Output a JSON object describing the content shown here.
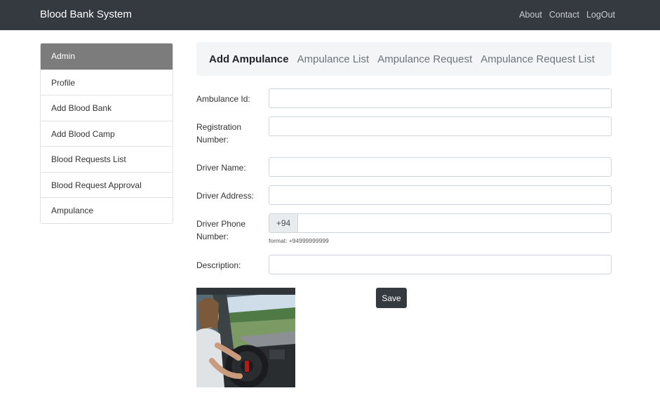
{
  "navbar": {
    "brand": "Blood Bank System",
    "links": [
      "About",
      "Contact",
      "LogOut"
    ]
  },
  "sidebar": {
    "items": [
      {
        "label": "Admin",
        "active": true
      },
      {
        "label": "Profile"
      },
      {
        "label": "Add Blood Bank"
      },
      {
        "label": "Add Blood Camp"
      },
      {
        "label": "Blood Requests List"
      },
      {
        "label": "Blood Request Approval"
      },
      {
        "label": "Ampulance"
      }
    ]
  },
  "tabs": [
    {
      "label": "Add Ampulance",
      "active": true
    },
    {
      "label": "Ampulance List"
    },
    {
      "label": "Ampulance Request"
    },
    {
      "label": "Ampulance Request List"
    }
  ],
  "form": {
    "ambulance_id": {
      "label": "Ambulance Id:",
      "value": ""
    },
    "registration": {
      "label": "Registration Number:",
      "value": ""
    },
    "driver_name": {
      "label": "Driver Name:",
      "value": ""
    },
    "driver_address": {
      "label": "Driver Address:",
      "value": ""
    },
    "driver_phone": {
      "label": "Driver Phone Number:",
      "prefix": "+94",
      "value": "",
      "hint": "format: +94999999999"
    },
    "description": {
      "label": "Description:",
      "value": ""
    },
    "save_label": "Save"
  },
  "colors": {
    "navbar": "#343a40",
    "sidebar_active": "#7c7c7c",
    "tabs_bg": "#f4f5f7",
    "button": "#343a40"
  }
}
